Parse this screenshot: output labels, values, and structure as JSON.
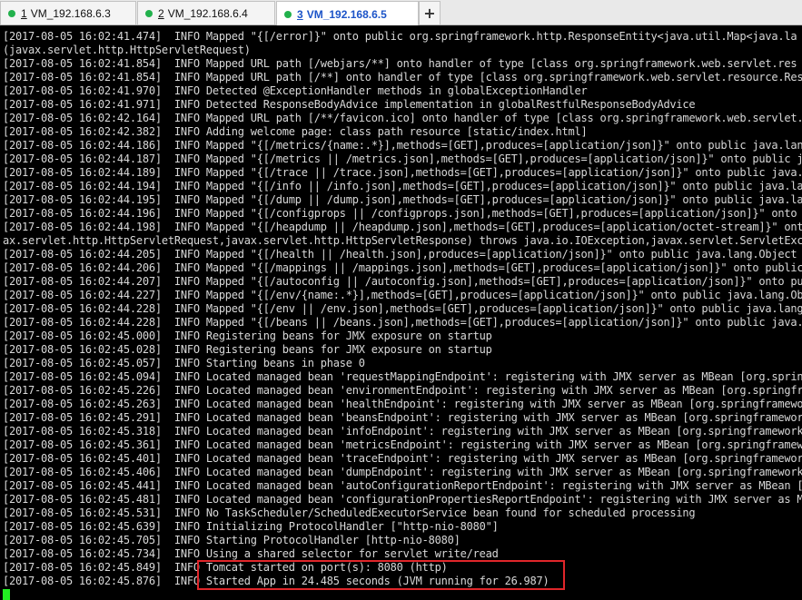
{
  "tabs": [
    {
      "number": "1",
      "label": "VM_192.168.6.3",
      "active": false,
      "status_color": "#22b14c"
    },
    {
      "number": "2",
      "label": "VM_192.168.6.4",
      "active": false,
      "status_color": "#22b14c"
    },
    {
      "number": "3",
      "label": "VM_192.168.6.5",
      "active": true,
      "status_color": "#22b14c"
    }
  ],
  "new_tab_label": "+",
  "colors": {
    "terminal_bg": "#000000",
    "terminal_text": "#d8d8d8",
    "active_tab_text": "#1c54c8",
    "highlight_border": "#e0262a",
    "cursor": "#22ee22"
  },
  "terminal": {
    "lines": [
      "[2017-08-05 16:02:41.474]  INFO Mapped \"{[/error]}\" onto public org.springframework.http.ResponseEntity<java.util.Map<java.la",
      "(javax.servlet.http.HttpServletRequest)",
      "[2017-08-05 16:02:41.854]  INFO Mapped URL path [/webjars/**] onto handler of type [class org.springframework.web.servlet.res",
      "[2017-08-05 16:02:41.854]  INFO Mapped URL path [/**] onto handler of type [class org.springframework.web.servlet.resource.Res",
      "[2017-08-05 16:02:41.970]  INFO Detected @ExceptionHandler methods in globalExceptionHandler",
      "[2017-08-05 16:02:41.971]  INFO Detected ResponseBodyAdvice implementation in globalRestfulResponseBodyAdvice",
      "[2017-08-05 16:02:42.164]  INFO Mapped URL path [/**/favicon.ico] onto handler of type [class org.springframework.web.servlet.",
      "[2017-08-05 16:02:42.382]  INFO Adding welcome page: class path resource [static/index.html]",
      "[2017-08-05 16:02:44.186]  INFO Mapped \"{[/metrics/{name:.*}],methods=[GET],produces=[application/json]}\" onto public java.lan",
      "[2017-08-05 16:02:44.187]  INFO Mapped \"{[/metrics || /metrics.json],methods=[GET],produces=[application/json]}\" onto public j",
      "[2017-08-05 16:02:44.189]  INFO Mapped \"{[/trace || /trace.json],methods=[GET],produces=[application/json]}\" onto public java.",
      "[2017-08-05 16:02:44.194]  INFO Mapped \"{[/info || /info.json],methods=[GET],produces=[application/json]}\" onto public java.la",
      "[2017-08-05 16:02:44.195]  INFO Mapped \"{[/dump || /dump.json],methods=[GET],produces=[application/json]}\" onto public java.la",
      "[2017-08-05 16:02:44.196]  INFO Mapped \"{[/configprops || /configprops.json],methods=[GET],produces=[application/json]}\" onto ",
      "[2017-08-05 16:02:44.198]  INFO Mapped \"{[/heapdump || /heapdump.json],methods=[GET],produces=[application/octet-stream]}\" ont",
      "ax.servlet.http.HttpServletRequest,javax.servlet.http.HttpServletResponse) throws java.io.IOException,javax.servlet.ServletExc",
      "[2017-08-05 16:02:44.205]  INFO Mapped \"{[/health || /health.json],produces=[application/json]}\" onto public java.lang.Object ",
      "[2017-08-05 16:02:44.206]  INFO Mapped \"{[/mappings || /mappings.json],methods=[GET],produces=[application/json]}\" onto public",
      "[2017-08-05 16:02:44.207]  INFO Mapped \"{[/autoconfig || /autoconfig.json],methods=[GET],produces=[application/json]}\" onto pu",
      "[2017-08-05 16:02:44.227]  INFO Mapped \"{[/env/{name:.*}],methods=[GET],produces=[application/json]}\" onto public java.lang.Obj",
      "[2017-08-05 16:02:44.228]  INFO Mapped \"{[/env || /env.json],methods=[GET],produces=[application/json]}\" onto public java.lang",
      "[2017-08-05 16:02:44.228]  INFO Mapped \"{[/beans || /beans.json],methods=[GET],produces=[application/json]}\" onto public java.l",
      "[2017-08-05 16:02:45.000]  INFO Registering beans for JMX exposure on startup",
      "[2017-08-05 16:02:45.028]  INFO Registering beans for JMX exposure on startup",
      "[2017-08-05 16:02:45.057]  INFO Starting beans in phase 0",
      "[2017-08-05 16:02:45.094]  INFO Located managed bean 'requestMappingEndpoint': registering with JMX server as MBean [org.sprin",
      "[2017-08-05 16:02:45.226]  INFO Located managed bean 'environmentEndpoint': registering with JMX server as MBean [org.springfra",
      "[2017-08-05 16:02:45.263]  INFO Located managed bean 'healthEndpoint': registering with JMX server as MBean [org.springframewo",
      "[2017-08-05 16:02:45.291]  INFO Located managed bean 'beansEndpoint': registering with JMX server as MBean [org.springframework",
      "[2017-08-05 16:02:45.318]  INFO Located managed bean 'infoEndpoint': registering with JMX server as MBean [org.springframework",
      "[2017-08-05 16:02:45.361]  INFO Located managed bean 'metricsEndpoint': registering with JMX server as MBean [org.springframewo",
      "[2017-08-05 16:02:45.401]  INFO Located managed bean 'traceEndpoint': registering with JMX server as MBean [org.springframework",
      "[2017-08-05 16:02:45.406]  INFO Located managed bean 'dumpEndpoint': registering with JMX server as MBean [org.springframework",
      "[2017-08-05 16:02:45.441]  INFO Located managed bean 'autoConfigurationReportEndpoint': registering with JMX server as MBean [",
      "[2017-08-05 16:02:45.481]  INFO Located managed bean 'configurationPropertiesReportEndpoint': registering with JMX server as M",
      "[2017-08-05 16:02:45.531]  INFO No TaskScheduler/ScheduledExecutorService bean found for scheduled processing",
      "[2017-08-05 16:02:45.639]  INFO Initializing ProtocolHandler [\"http-nio-8080\"]",
      "[2017-08-05 16:02:45.705]  INFO Starting ProtocolHandler [http-nio-8080]",
      "[2017-08-05 16:02:45.734]  INFO Using a shared selector for servlet write/read",
      "[2017-08-05 16:02:45.849]  INFO Tomcat started on port(s): 8080 (http)",
      "[2017-08-05 16:02:45.876]  INFO Started App in 24.485 seconds (JVM running for 26.987)"
    ]
  }
}
